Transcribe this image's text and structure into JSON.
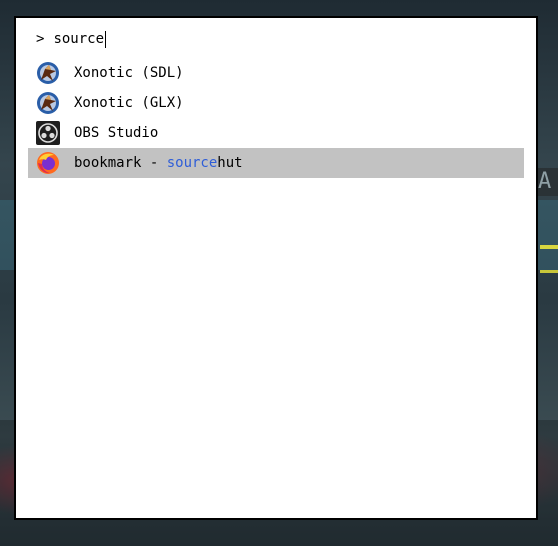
{
  "launcher": {
    "prompt": ">",
    "query": "source"
  },
  "results": [
    {
      "label": "Xonotic (SDL)",
      "icon": "xonotic-icon"
    },
    {
      "label": "Xonotic (GLX)",
      "icon": "xonotic-icon"
    },
    {
      "label": "OBS Studio",
      "icon": "obs-studio-icon"
    },
    {
      "label_prefix": "bookmark - ",
      "label_match": "source",
      "label_suffix": "hut",
      "icon": "firefox-icon",
      "selected": true
    }
  ],
  "colors": {
    "selection": "#c2c2c2",
    "match_highlight": "#2f5ed8"
  }
}
